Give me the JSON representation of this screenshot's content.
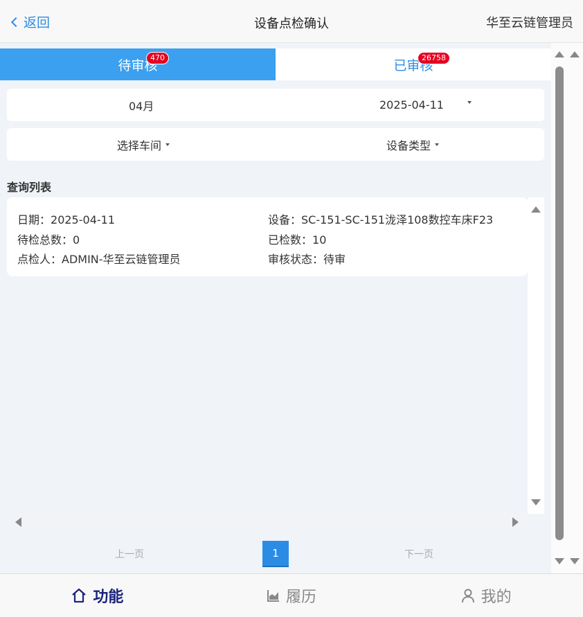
{
  "header": {
    "back_label": "返回",
    "title": "设备点检确认",
    "user": "华至云链管理员"
  },
  "tabs": [
    {
      "label": "待审核",
      "badge": "470",
      "active": true
    },
    {
      "label": "已审核",
      "badge": "26758",
      "active": false
    }
  ],
  "filters": {
    "month": "04月",
    "date": "2025-04-11",
    "workshop": "选择车间",
    "device_type": "设备类型"
  },
  "section_title": "查询列表",
  "records": [
    {
      "date_label": "日期：",
      "date": "2025-04-11",
      "device_label": "设备：",
      "device": "SC-151-SC-151泷泽108数控车床F23",
      "pending_label": "待检总数：",
      "pending": "0",
      "checked_label": "已检数：",
      "checked": "10",
      "inspector_label": "点检人：",
      "inspector": "ADMIN-华至云链管理员",
      "status_label": "审核状态：",
      "status": "待审"
    }
  ],
  "pager": {
    "prev": "上一页",
    "page": "1",
    "next": "下一页"
  },
  "bottom_nav": [
    {
      "label": "功能",
      "icon": "home-icon",
      "active": true
    },
    {
      "label": "履历",
      "icon": "chart-icon",
      "active": false
    },
    {
      "label": "我的",
      "icon": "user-icon",
      "active": false
    }
  ],
  "colors": {
    "accent": "#2b8ce6",
    "tab_active": "#3ba0ef",
    "badge": "#e60021",
    "nav_active": "#1a237e"
  }
}
